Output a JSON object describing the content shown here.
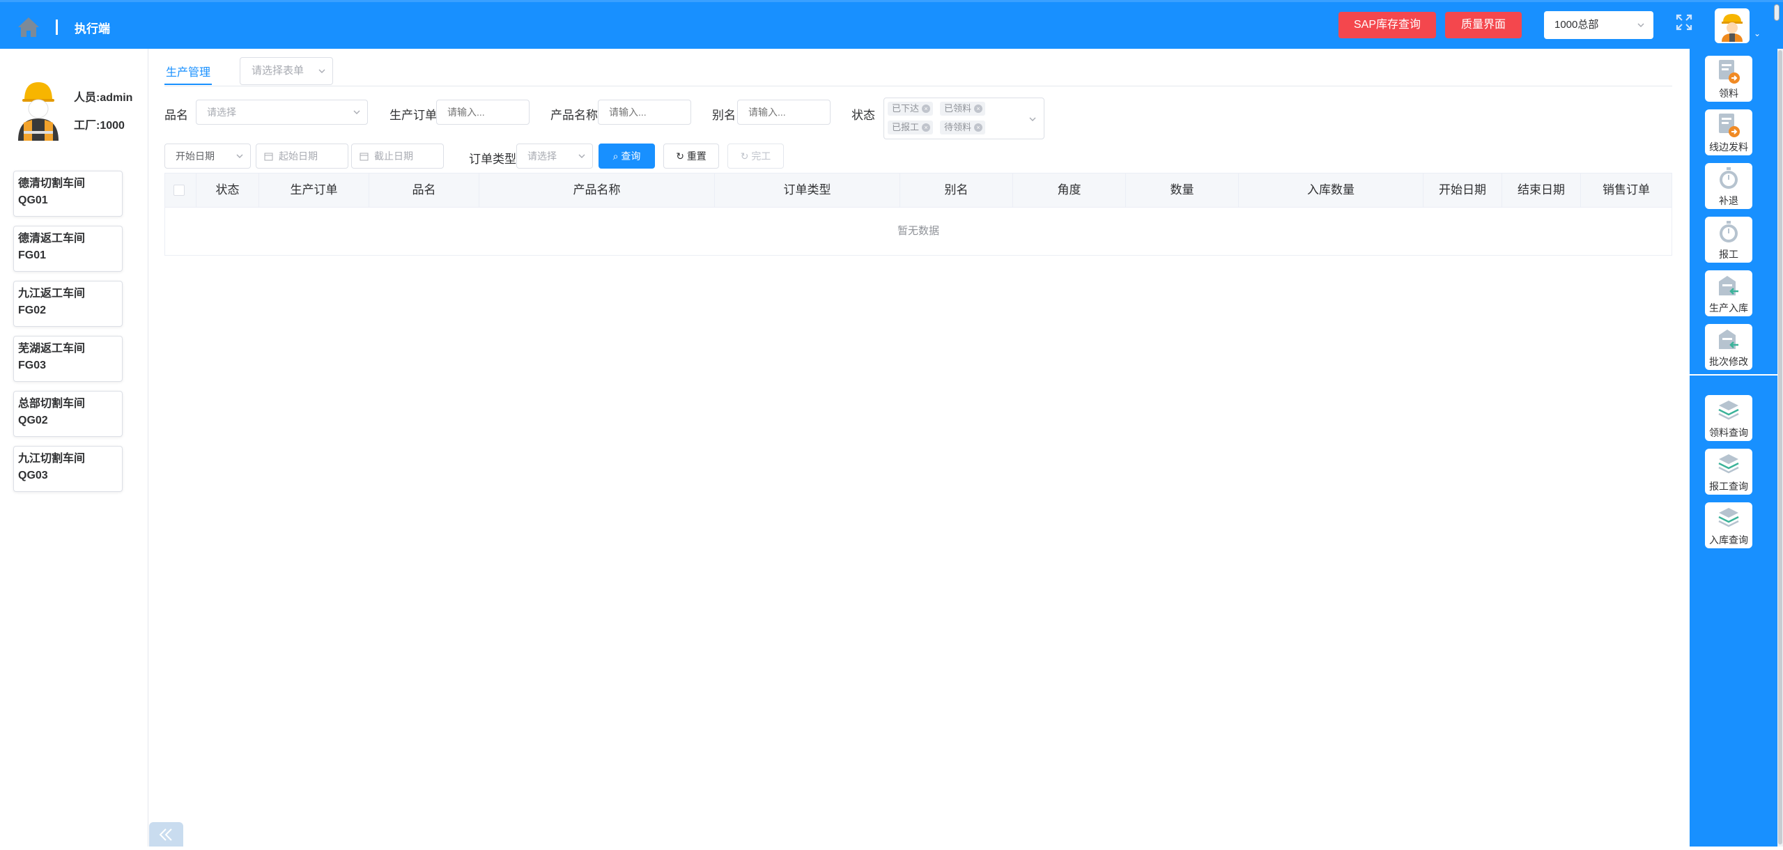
{
  "header": {
    "title": "执行端",
    "sap_button": "SAP库存查询",
    "quality_button": "质量界面",
    "org_select_value": "1000总部"
  },
  "user": {
    "name_label": "人员:admin",
    "factory_label": "工厂:1000"
  },
  "workshops": [
    {
      "name": "德清切割车间",
      "code": "QG01"
    },
    {
      "name": "德清返工车间",
      "code": "FG01"
    },
    {
      "name": "九江返工车间",
      "code": "FG02"
    },
    {
      "name": "芜湖返工车间",
      "code": "FG03"
    },
    {
      "name": "总部切割车间",
      "code": "QG02"
    },
    {
      "name": "九江切割车间",
      "code": "QG03"
    }
  ],
  "tabs": {
    "active": "生产管理",
    "form_select_placeholder": "请选择表单"
  },
  "filters": {
    "product_name_label": "品名",
    "product_name_placeholder": "请选择",
    "order_label": "生产订单",
    "order_placeholder": "请输入...",
    "product_label": "产品名称",
    "product_placeholder": "请输入...",
    "alias_label": "别名",
    "alias_placeholder": "请输入...",
    "status_label": "状态",
    "status_tags": [
      "已下达",
      "已领料",
      "已报工",
      "待领料"
    ],
    "date_type": "开始日期",
    "start_date_placeholder": "起始日期",
    "end_date_placeholder": "截止日期",
    "order_type_label": "订单类型",
    "order_type_placeholder": "请选择",
    "query_button": "查询",
    "reset_button": "重置",
    "finish_button": "完工"
  },
  "table": {
    "columns": [
      "状态",
      "生产订单",
      "品名",
      "产品名称",
      "订单类型",
      "别名",
      "角度",
      "数量",
      "入库数量",
      "开始日期",
      "结束日期",
      "销售订单"
    ],
    "empty_text": "暂无数据"
  },
  "rightbar": {
    "top": [
      "领料",
      "线边发料",
      "补退",
      "报工",
      "生产入库",
      "批次修改"
    ],
    "bottom": [
      "领料查询",
      "报工查询",
      "入库查询"
    ]
  },
  "colors": {
    "primary": "#1890ff",
    "danger": "#f4474d"
  }
}
